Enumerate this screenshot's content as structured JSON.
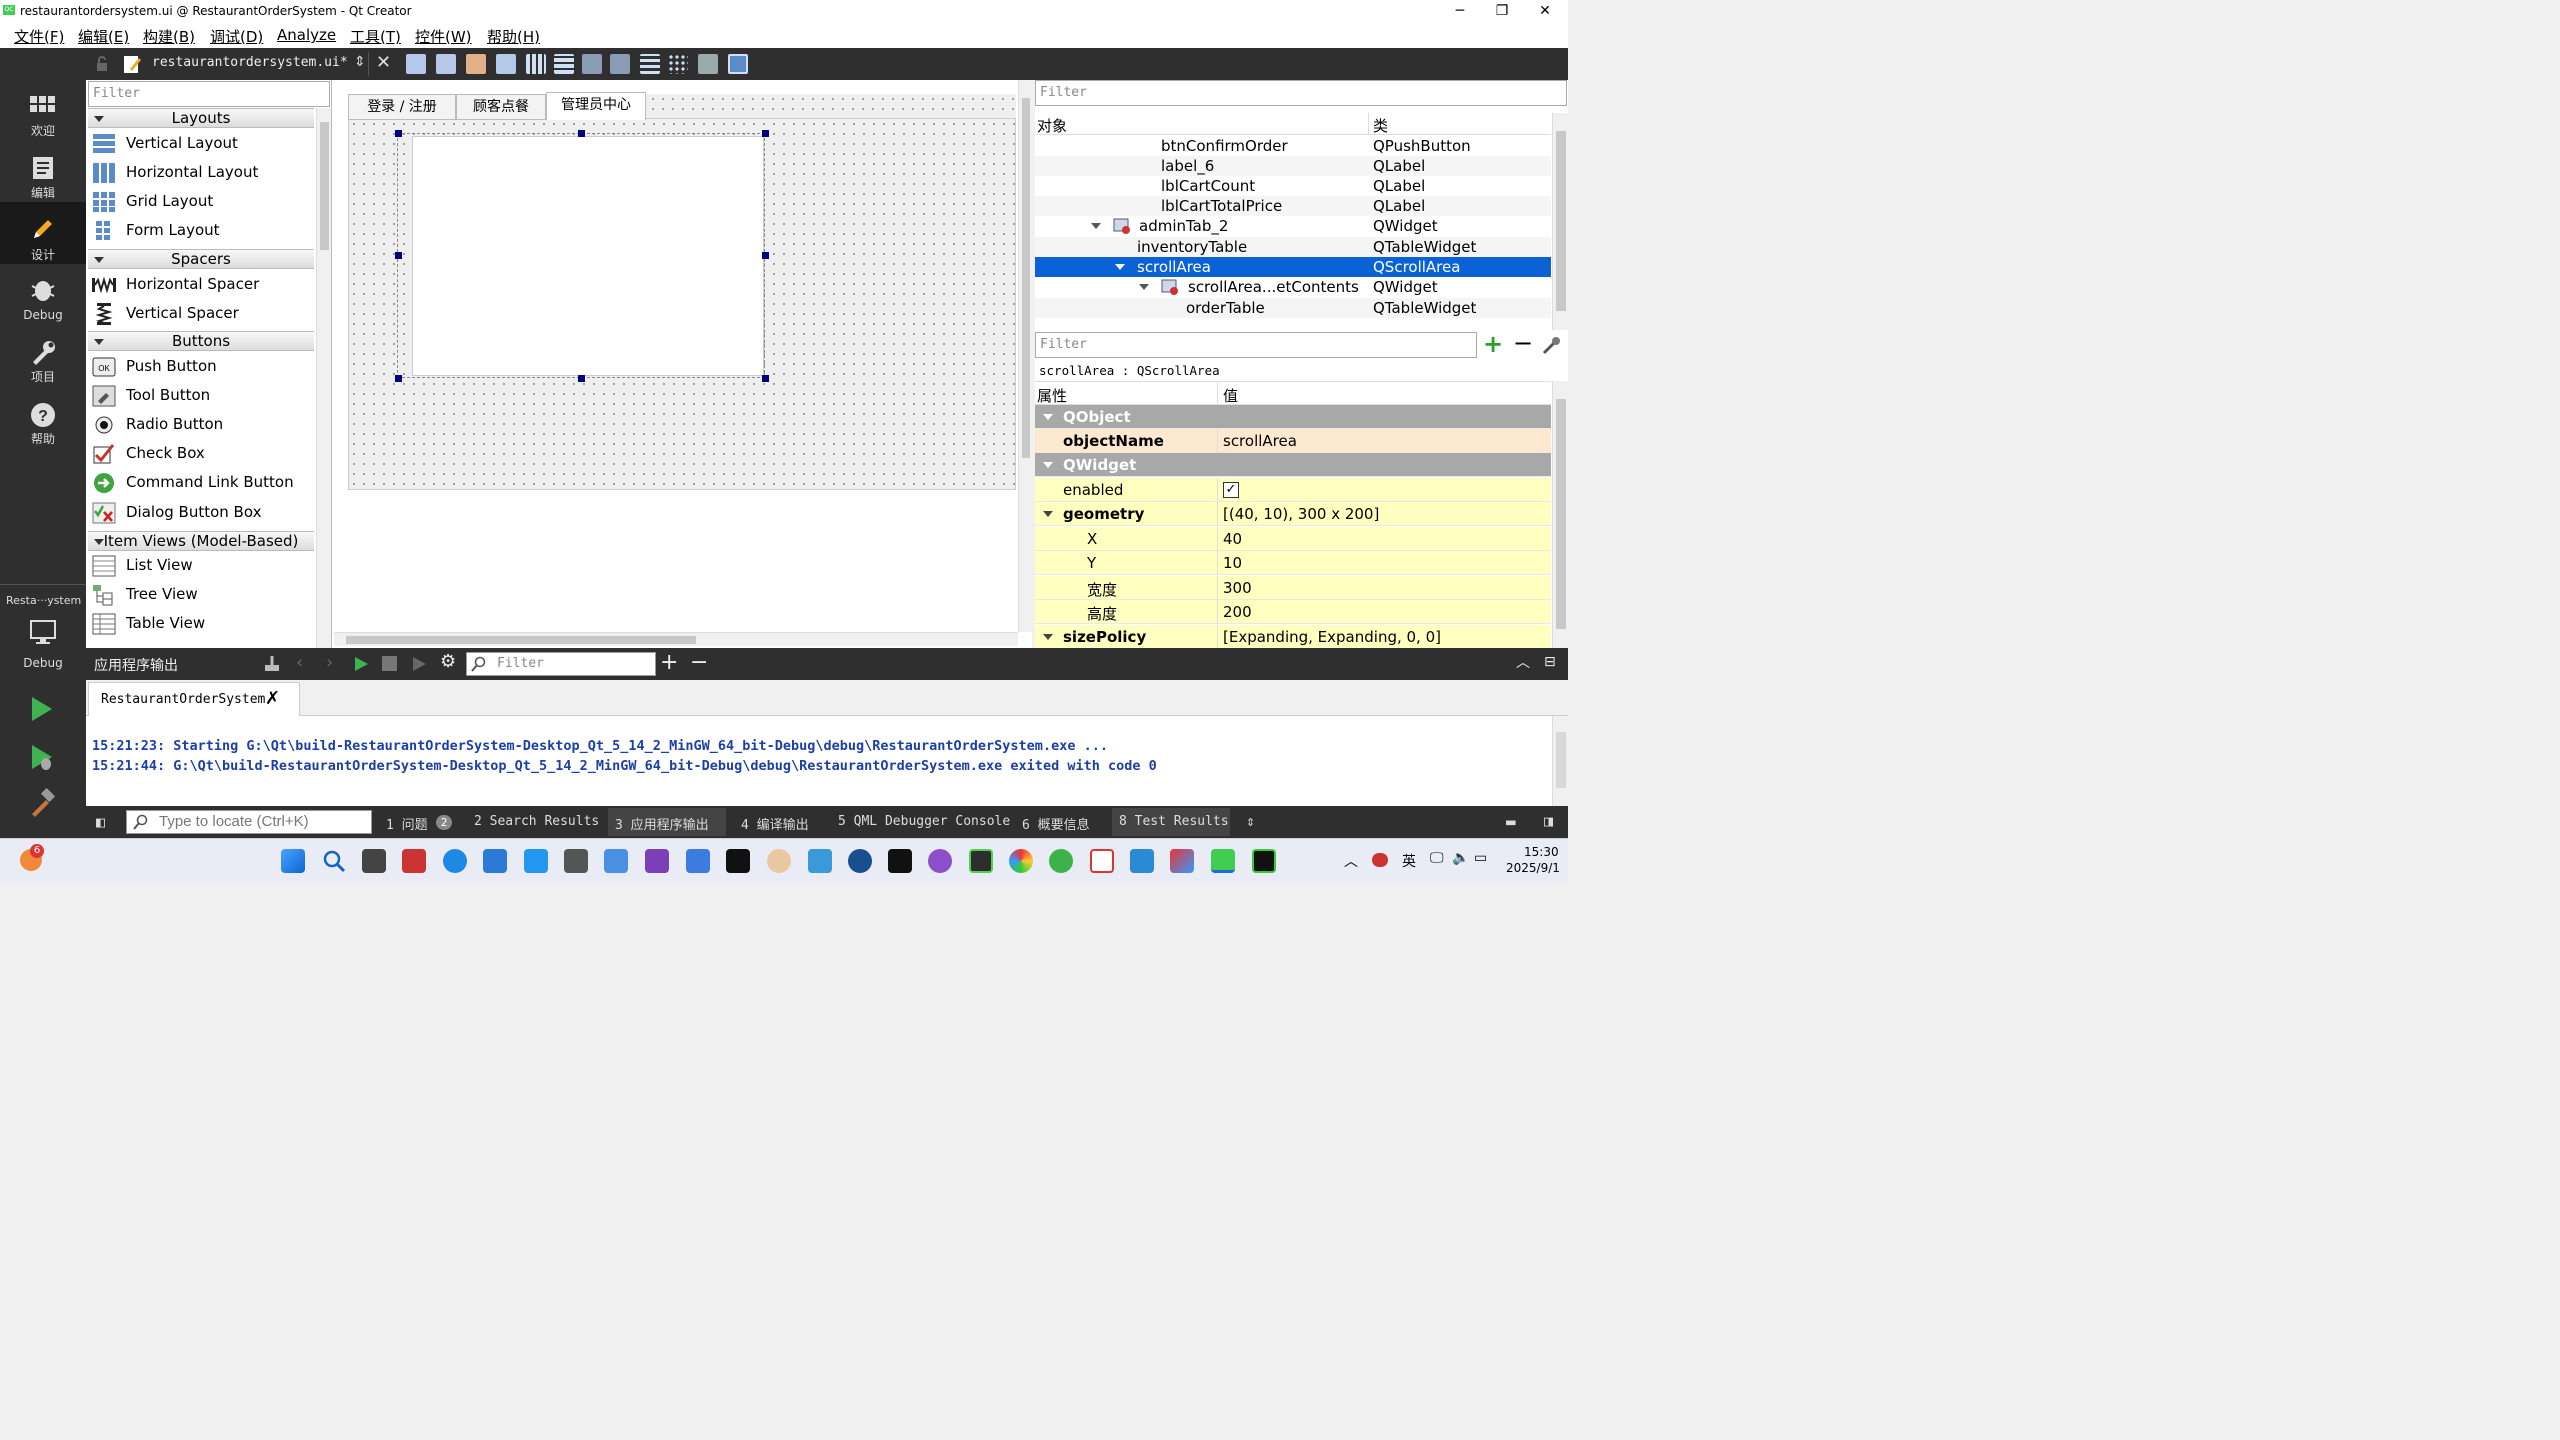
{
  "window": {
    "title": "restaurantordersystem.ui @ RestaurantOrderSystem - Qt Creator",
    "minimize": "─",
    "maximize": "❐",
    "close": "✕"
  },
  "menu": [
    "文件(F)",
    "编辑(E)",
    "构建(B)",
    "调试(D)",
    "Analyze",
    "工具(T)",
    "控件(W)",
    "帮助(H)"
  ],
  "modes": {
    "welcome": "欢迎",
    "edit": "编辑",
    "design": "设计",
    "debug": "Debug",
    "project": "项目",
    "help": "帮助",
    "kit": "Resta···ystem",
    "kit_mode": "Debug"
  },
  "toolbar": {
    "file": "restaurantordersystem.ui*"
  },
  "widgetbox": {
    "filter_placeholder": "Filter",
    "categories": {
      "layouts": "Layouts",
      "spacers": "Spacers",
      "buttons": "Buttons",
      "itemviews": "Item Views (Model-Based)"
    },
    "items": {
      "vlayout": "Vertical Layout",
      "hlayout": "Horizontal Layout",
      "grid": "Grid Layout",
      "form": "Form Layout",
      "hspacer": "Horizontal Spacer",
      "vspacer": "Vertical Spacer",
      "push": "Push Button",
      "tool": "Tool Button",
      "radio": "Radio Button",
      "check": "Check Box",
      "cmdlink": "Command Link Button",
      "dialogbox": "Dialog Button Box",
      "list": "List View",
      "tree": "Tree View",
      "table": "Table View"
    }
  },
  "form": {
    "tabs": [
      "登录 / 注册",
      "顾客点餐",
      "管理员中心"
    ]
  },
  "objects": {
    "filter_placeholder": "Filter",
    "col_object": "对象",
    "col_class": "类",
    "rows": [
      {
        "name": "btnConfirmOrder",
        "cls": "QPushButton"
      },
      {
        "name": "label_6",
        "cls": "QLabel"
      },
      {
        "name": "lblCartCount",
        "cls": "QLabel"
      },
      {
        "name": "lblCartTotalPrice",
        "cls": "QLabel"
      },
      {
        "name": "adminTab_2",
        "cls": "QWidget"
      },
      {
        "name": "inventoryTable",
        "cls": "QTableWidget"
      },
      {
        "name": "scrollArea",
        "cls": "QScrollArea"
      },
      {
        "name": "scrollArea...etContents",
        "cls": "QWidget"
      },
      {
        "name": "orderTable",
        "cls": "QTableWidget"
      }
    ]
  },
  "props": {
    "filter_placeholder": "Filter",
    "context": "scrollArea : QScrollArea",
    "col_prop": "属性",
    "col_val": "值",
    "rows": [
      {
        "name": "QObject",
        "value": ""
      },
      {
        "name": "objectName",
        "value": "scrollArea"
      },
      {
        "name": "QWidget",
        "value": ""
      },
      {
        "name": "enabled",
        "value": "✓"
      },
      {
        "name": "geometry",
        "value": "[(40, 10), 300 x 200]"
      },
      {
        "name": "X",
        "value": "40"
      },
      {
        "name": "Y",
        "value": "10"
      },
      {
        "name": "宽度",
        "value": "300"
      },
      {
        "name": "高度",
        "value": "200"
      },
      {
        "name": "sizePolicy",
        "value": "[Expanding, Expanding, 0, 0]"
      }
    ]
  },
  "output": {
    "title": "应用程序输出",
    "filter_placeholder": "Filter",
    "tab": "RestaurantOrderSystem",
    "lines": [
      "15:21:23: Starting G:\\Qt\\build-RestaurantOrderSystem-Desktop_Qt_5_14_2_MinGW_64_bit-Debug\\debug\\RestaurantOrderSystem.exe ...",
      "15:21:44: G:\\Qt\\build-RestaurantOrderSystem-Desktop_Qt_5_14_2_MinGW_64_bit-Debug\\debug\\RestaurantOrderSystem.exe exited with code 0"
    ]
  },
  "status": {
    "locate_placeholder": "Type to locate (Ctrl+K)",
    "tabs": [
      "1  问题",
      "2  Search Results",
      "3  应用程序输出",
      "4  编译输出",
      "5  QML Debugger Console",
      "6  概要信息",
      "8  Test Results"
    ],
    "issues_count": "2"
  },
  "taskbar": {
    "notif_count": "6",
    "lang": "英",
    "time": "15:30",
    "date": "2025/9/1"
  }
}
